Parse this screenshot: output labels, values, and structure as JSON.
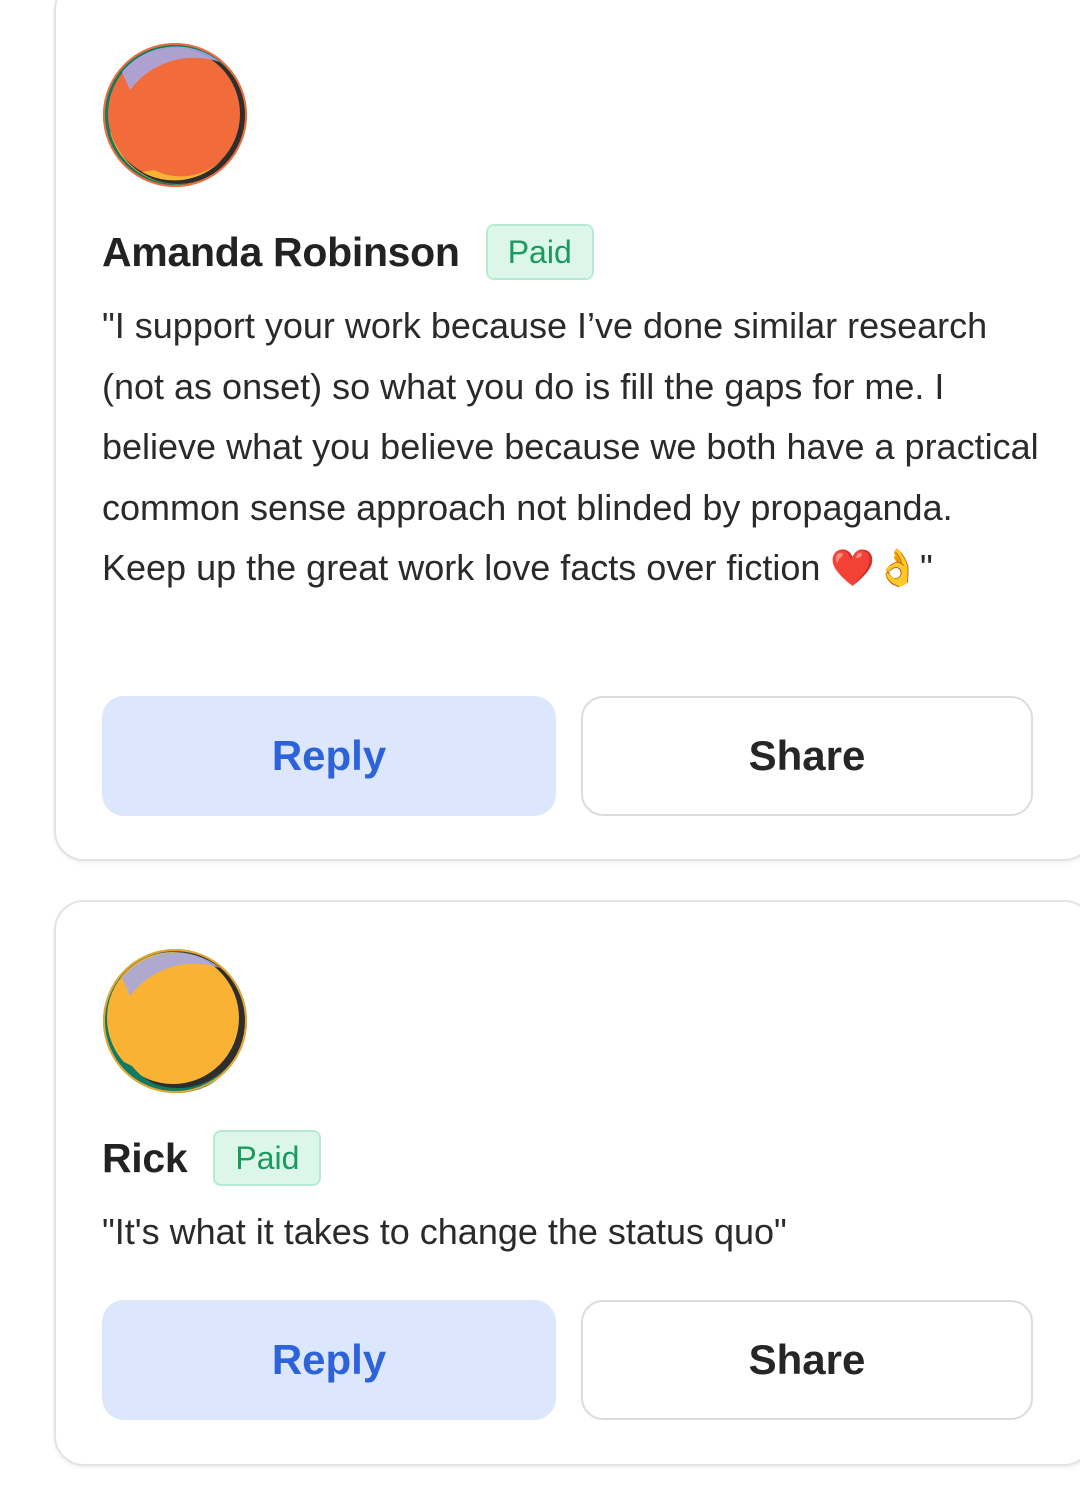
{
  "comments": [
    {
      "author": "Amanda Robinson",
      "badge": "Paid",
      "text": "\"I support your work because I’ve done similar research (not as onset) so what you do is fill the gaps for me. I believe what you believe because we both have a practical common sense approach not blinded by propaganda. Keep up the great work love facts over fiction ❤️👌\"",
      "avatar": {
        "icon": "abstract-circle-avatar-icon",
        "main_color": "#f26b3a",
        "colors": [
          "#f26b3a",
          "#f9b233",
          "#0f7b62",
          "#a7a7e0",
          "#2e2e2e"
        ]
      },
      "reply_label": "Reply",
      "share_label": "Share"
    },
    {
      "author": "Rick",
      "badge": "Paid",
      "text": "\"It's what it takes to change the status quo\"",
      "avatar": {
        "icon": "abstract-circle-avatar-icon",
        "main_color": "#f9b233",
        "colors": [
          "#f9b233",
          "#f26b3a",
          "#0f7b62",
          "#a7a7e0",
          "#2e2e2e"
        ]
      },
      "reply_label": "Reply",
      "share_label": "Share"
    }
  ],
  "colors": {
    "badge_text": "#1b9a5e",
    "badge_bg": "#dcf6ea",
    "reply_bg": "#dce6fd",
    "reply_text": "#2d63d8"
  }
}
